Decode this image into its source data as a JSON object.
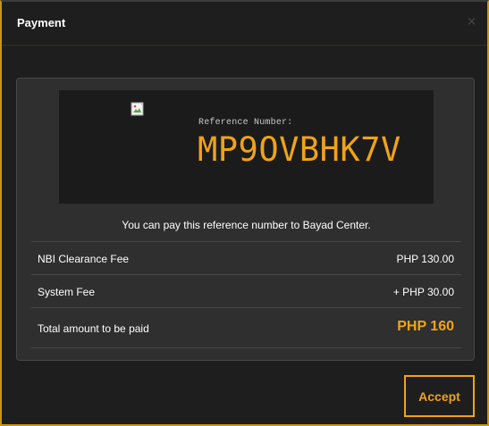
{
  "dialog": {
    "title": "Payment",
    "close_glyph": "×"
  },
  "reference": {
    "label": "Reference Number:",
    "code": "MP9OVBHK7V",
    "image_icon": "broken-image-icon"
  },
  "note": "You can pay this reference number to Bayad Center.",
  "fees": [
    {
      "label": "NBI Clearance Fee",
      "value": "PHP 130.00"
    },
    {
      "label": "System Fee",
      "value": "+ PHP 30.00"
    }
  ],
  "total": {
    "label": "Total amount to be paid",
    "value": "PHP 160"
  },
  "actions": {
    "accept_label": "Accept"
  },
  "colors": {
    "accent": "#f0a318",
    "background": "#1e1e1e",
    "panel": "#2f2f2f"
  }
}
